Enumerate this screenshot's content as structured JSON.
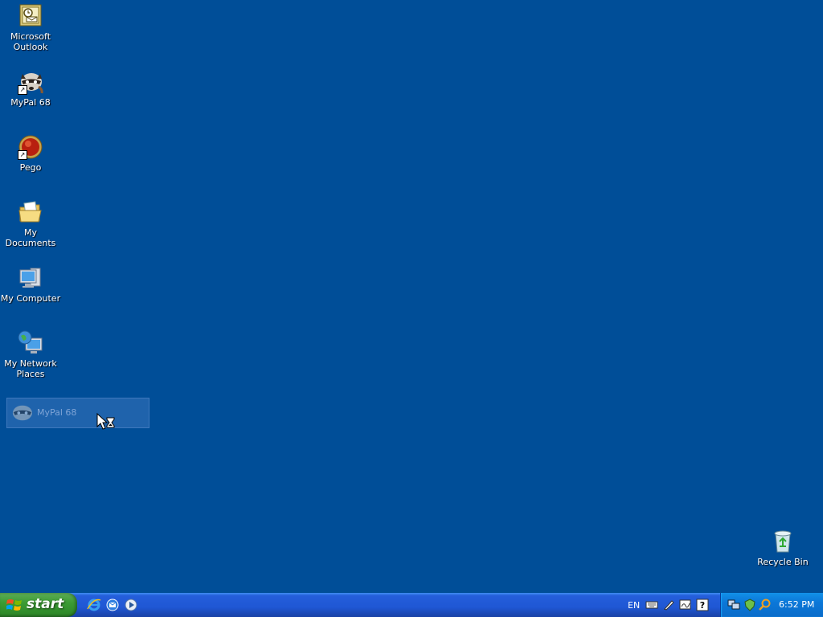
{
  "desktop": {
    "background_color": "#004e98",
    "icons": [
      {
        "label": "Microsoft Outlook",
        "icon": "outlook-icon"
      },
      {
        "label": "MyPal 68",
        "icon": "mypal-raccoon-icon",
        "shortcut": true
      },
      {
        "label": "Pego",
        "icon": "pego-icon",
        "shortcut": true
      },
      {
        "label": "My Documents",
        "icon": "my-documents-folder-icon"
      },
      {
        "label": "My Computer",
        "icon": "my-computer-icon"
      },
      {
        "label": "My Network Places",
        "icon": "network-places-icon"
      },
      {
        "label": "Recycle Bin",
        "icon": "recycle-bin-icon"
      }
    ],
    "drag_ghost": {
      "label": "MyPal 68",
      "icon": "mypal-raccoon-icon"
    },
    "cursor": "arrow-hourglass-busy-cursor"
  },
  "taskbar": {
    "start_label": "start",
    "quick_launch": [
      "internet-explorer-icon",
      "outlook-express-icon",
      "media-player-icon"
    ],
    "tray": {
      "language": "EN",
      "language_bar_icons": [
        "keyboard-icon",
        "pen-icon",
        "handwriting-icon",
        "help-icon"
      ],
      "notification_icons": [
        "network-icon",
        "security-icon",
        "search-icon"
      ],
      "clock": "6:52 PM"
    }
  }
}
